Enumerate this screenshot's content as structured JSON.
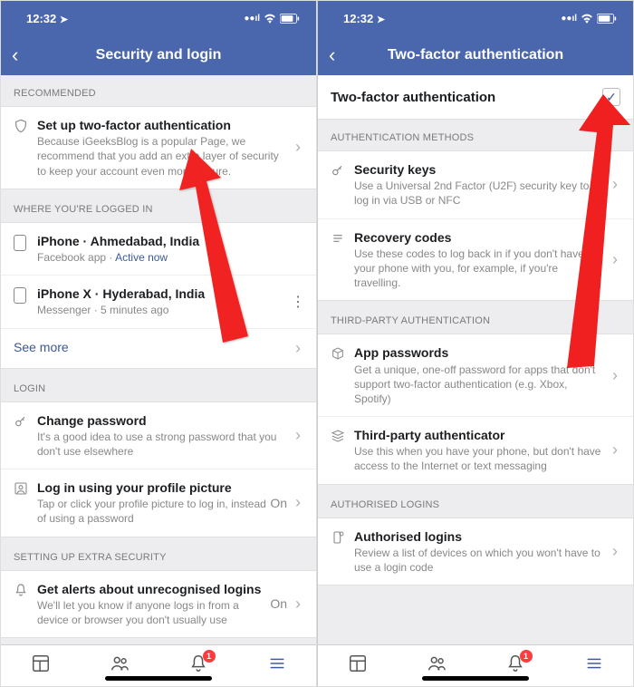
{
  "left": {
    "status": {
      "time": "12:32",
      "signal": "••ıl",
      "wifi": "◉",
      "battery": "▢"
    },
    "title": "Security and login",
    "sections": {
      "recommended": {
        "header": "RECOMMENDED",
        "item": {
          "title": "Set up two-factor authentication",
          "desc": "Because iGeeksBlog is a popular Page, we recommend that you add an extra layer of security to keep your account even more secure."
        }
      },
      "logged_in": {
        "header": "WHERE YOU'RE LOGGED IN",
        "rows": [
          {
            "title": "iPhone · Ahmedabad, India",
            "sub_prefix": "Facebook app · ",
            "sub_link": "Active now"
          },
          {
            "title": "iPhone X · Hyderabad, India",
            "sub": "Messenger · 5 minutes ago"
          }
        ],
        "seemore": "See more"
      },
      "login": {
        "header": "LOGIN",
        "rows": [
          {
            "title": "Change password",
            "desc": "It's a good idea to use a strong password that you don't use elsewhere"
          },
          {
            "title": "Log in using your profile picture",
            "desc": "Tap or click your profile picture to log in, instead of using a password",
            "value": "On"
          }
        ]
      },
      "extra": {
        "header": "SETTING UP EXTRA SECURITY",
        "row": {
          "title": "Get alerts about unrecognised logins",
          "desc": "We'll let you know if anyone logs in from a device or browser you don't usually use",
          "value": "On"
        }
      }
    },
    "tabs": {
      "badge": "1"
    }
  },
  "right": {
    "status": {
      "time": "12:32"
    },
    "title": "Two-factor authentication",
    "switch": {
      "label": "Two-factor authentication",
      "checked": true
    },
    "sections": {
      "auth_methods": {
        "header": "AUTHENTICATION METHODS",
        "rows": [
          {
            "title": "Security keys",
            "desc": "Use a Universal 2nd Factor (U2F) security key to log in via USB or NFC"
          },
          {
            "title": "Recovery codes",
            "desc": "Use these codes to log back in if you don't have your phone with you, for example, if you're travelling."
          }
        ]
      },
      "third_party": {
        "header": "THIRD-PARTY AUTHENTICATION",
        "rows": [
          {
            "title": "App passwords",
            "desc": "Get a unique, one-off password for apps that don't support two-factor authentication (e.g. Xbox, Spotify)"
          },
          {
            "title": "Third-party authenticator",
            "desc": "Use this when you have your phone, but don't have access to the Internet or text messaging"
          }
        ]
      },
      "authorised": {
        "header": "AUTHORISED LOGINS",
        "row": {
          "title": "Authorised logins",
          "desc": "Review a list of devices on which you won't have to use a login code"
        }
      }
    },
    "tabs": {
      "badge": "1"
    }
  }
}
